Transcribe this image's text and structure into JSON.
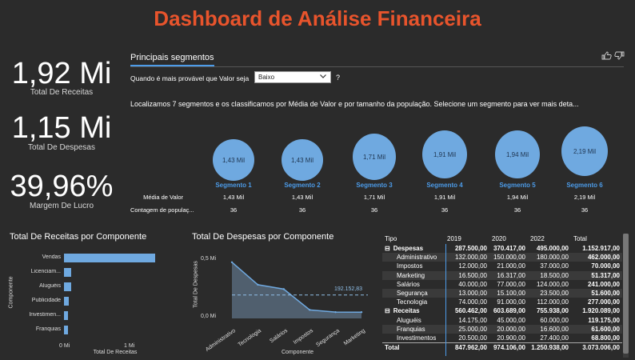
{
  "header": {
    "title": "Dashboard de Análise Financeira"
  },
  "kpis": [
    {
      "value": "1,92 Mi",
      "label": "Total De Receitas"
    },
    {
      "value": "1,15 Mi",
      "label": "Total De Despesas"
    },
    {
      "value": "39,96%",
      "label": "Margem De Lucro"
    }
  ],
  "segments_panel": {
    "tab_label": "Principais segmentos",
    "filter_label": "Quando é mais provável que Valor seja",
    "filter_value": "Baixo",
    "help": "?",
    "description": "Localizamos 7 segmentos e os classificamos por Média de Valor e por tamanho da população. Selecione um segmento para ver mais deta...",
    "row_labels": {
      "avg": "Média de Valor",
      "count": "Contagem de populaç..."
    },
    "segments": [
      {
        "bubble": "1,43 Mil",
        "name": "Segmento 1",
        "avg": "1,43 Mil",
        "count": "36"
      },
      {
        "bubble": "1,43 Mil",
        "name": "Segmento 2",
        "avg": "1,43 Mil",
        "count": "36"
      },
      {
        "bubble": "1,71 Mil",
        "name": "Segmento 3",
        "avg": "1,71 Mil",
        "count": "36"
      },
      {
        "bubble": "1,91 Mil",
        "name": "Segmento 4",
        "avg": "1,91 Mil",
        "count": "36"
      },
      {
        "bubble": "1,94 Mil",
        "name": "Segmento 5",
        "avg": "1,94 Mil",
        "count": "36"
      },
      {
        "bubble": "2,19 Mil",
        "name": "Segmento 6",
        "avg": "2,19 Mil",
        "count": "36"
      }
    ]
  },
  "chart_data": [
    {
      "type": "bar",
      "orientation": "horizontal",
      "title": "Total De Receitas por Componente",
      "xlabel": "Total De Receitas",
      "ylabel": "Componente",
      "categories": [
        "Vendas",
        "Licenciam...",
        "Aluguéis",
        "Publicidade",
        "Investimen...",
        "Franquias"
      ],
      "values": [
        1500000,
        119175,
        119175,
        75000,
        68800,
        61600
      ],
      "xlim": [
        0,
        1500000
      ],
      "x_ticks": [
        "0 Mi",
        "1 Mi"
      ],
      "color": "#6fa9e0"
    },
    {
      "type": "area",
      "title": "Total De Despesas por Componente",
      "xlabel": "Componente",
      "ylabel": "Total De Despesas",
      "categories": [
        "Administrativo",
        "Tecnologia",
        "Salários",
        "Impostos",
        "Segurança",
        "Marketing"
      ],
      "values": [
        462000,
        277000,
        241000,
        70000,
        51600,
        51317
      ],
      "ylim": [
        0,
        500000
      ],
      "y_ticks": [
        "0,0 Mi",
        "0,5 Mi"
      ],
      "average_line": {
        "label": "192.152,83",
        "value": 192152.83
      },
      "color": "#6fa9e0"
    }
  ],
  "matrix": {
    "headers": [
      "Tipo",
      "2019",
      "2020",
      "2022",
      "Total"
    ],
    "rows": [
      {
        "kind": "grp",
        "expander": "⊟",
        "label": "Despesas",
        "v": [
          "287.500,00",
          "370.417,00",
          "495.000,00",
          "1.152.917,00"
        ]
      },
      {
        "kind": "child",
        "label": "Administrativo",
        "v": [
          "132.000,00",
          "150.000,00",
          "180.000,00",
          "462.000,00"
        ]
      },
      {
        "kind": "child",
        "label": "Impostos",
        "v": [
          "12.000,00",
          "21.000,00",
          "37.000,00",
          "70.000,00"
        ]
      },
      {
        "kind": "child",
        "label": "Marketing",
        "v": [
          "16.500,00",
          "16.317,00",
          "18.500,00",
          "51.317,00"
        ]
      },
      {
        "kind": "child",
        "label": "Salários",
        "v": [
          "40.000,00",
          "77.000,00",
          "124.000,00",
          "241.000,00"
        ]
      },
      {
        "kind": "child",
        "label": "Segurança",
        "v": [
          "13.000,00",
          "15.100,00",
          "23.500,00",
          "51.600,00"
        ]
      },
      {
        "kind": "child",
        "label": "Tecnologia",
        "v": [
          "74.000,00",
          "91.000,00",
          "112.000,00",
          "277.000,00"
        ]
      },
      {
        "kind": "grp",
        "expander": "⊟",
        "label": "Receitas",
        "v": [
          "560.462,00",
          "603.689,00",
          "755.938,00",
          "1.920.089,00"
        ]
      },
      {
        "kind": "child",
        "label": "Aluguéis",
        "v": [
          "14.175,00",
          "45.000,00",
          "60.000,00",
          "119.175,00"
        ]
      },
      {
        "kind": "child",
        "label": "Franquias",
        "v": [
          "25.000,00",
          "20.000,00",
          "16.600,00",
          "61.600,00"
        ]
      },
      {
        "kind": "child",
        "label": "Investimentos",
        "v": [
          "20.500,00",
          "20.900,00",
          "27.400,00",
          "68.800,00"
        ]
      },
      {
        "kind": "tot",
        "label": "Total",
        "v": [
          "847.962,00",
          "974.106,00",
          "1.250.938,00",
          "3.073.006,00"
        ]
      }
    ]
  },
  "icons": {
    "thumbs_up": "thumbs-up-icon",
    "thumbs_down": "thumbs-down-icon",
    "chevron": "chevron-down-icon"
  },
  "colors": {
    "title": "#e8542c",
    "accent": "#4c9be8",
    "bar": "#6fa9e0",
    "background": "#2b2b2b"
  }
}
